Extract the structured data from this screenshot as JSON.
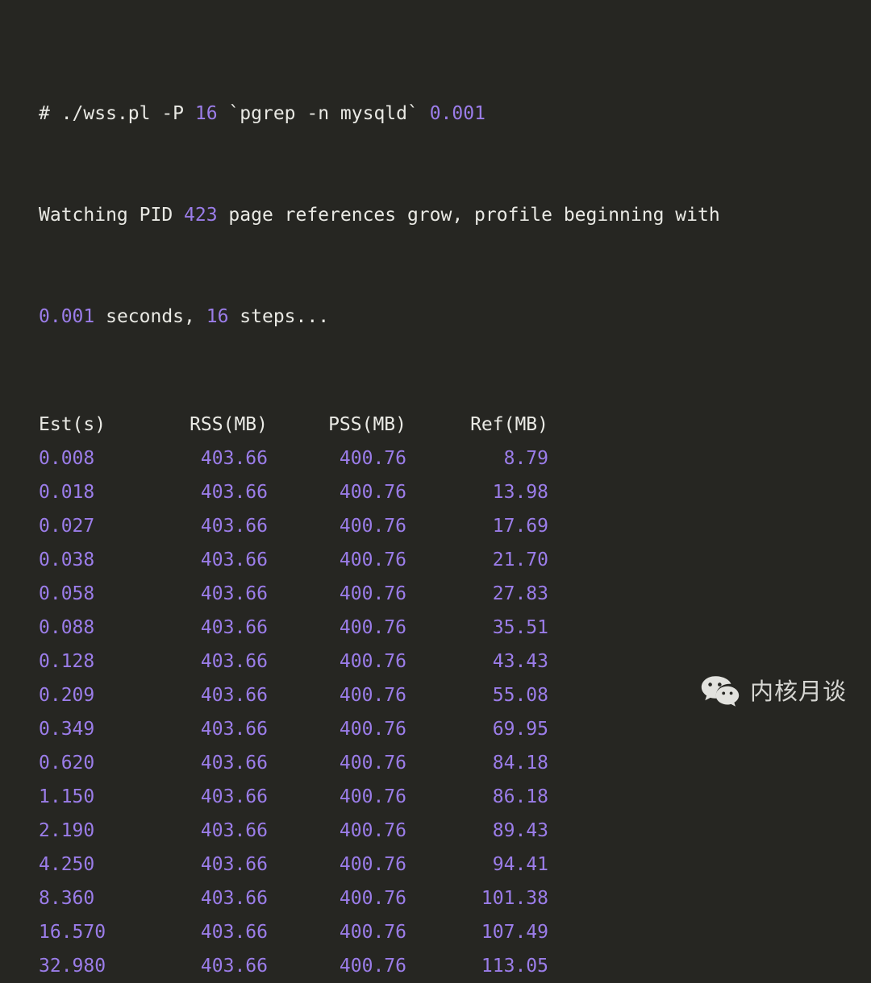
{
  "terminal": {
    "background_color": "#262622",
    "text_color": "#e9e9e4",
    "number_color": "#9b7de9",
    "command_line": {
      "prompt": "# ",
      "script": "./wss.pl -P ",
      "parallel_arg": "16",
      "target": " `pgrep -n mysqld` ",
      "interval": "0.001"
    },
    "status_line": {
      "part1": "Watching PID ",
      "pid": "423",
      "part2": " page references grow, profile beginning with",
      "part3_interval": "0.001",
      "part4": " seconds, ",
      "steps": "16",
      "part5": " steps..."
    }
  },
  "table": {
    "headers": [
      "Est(s)",
      "RSS(MB)",
      "PSS(MB)",
      "Ref(MB)"
    ],
    "rows": [
      [
        "0.008",
        "403.66",
        "400.76",
        "8.79"
      ],
      [
        "0.018",
        "403.66",
        "400.76",
        "13.98"
      ],
      [
        "0.027",
        "403.66",
        "400.76",
        "17.69"
      ],
      [
        "0.038",
        "403.66",
        "400.76",
        "21.70"
      ],
      [
        "0.058",
        "403.66",
        "400.76",
        "27.83"
      ],
      [
        "0.088",
        "403.66",
        "400.76",
        "35.51"
      ],
      [
        "0.128",
        "403.66",
        "400.76",
        "43.43"
      ],
      [
        "0.209",
        "403.66",
        "400.76",
        "55.08"
      ],
      [
        "0.349",
        "403.66",
        "400.76",
        "69.95"
      ],
      [
        "0.620",
        "403.66",
        "400.76",
        "84.18"
      ],
      [
        "1.150",
        "403.66",
        "400.76",
        "86.18"
      ],
      [
        "2.190",
        "403.66",
        "400.76",
        "89.43"
      ],
      [
        "4.250",
        "403.66",
        "400.76",
        "94.41"
      ],
      [
        "8.360",
        "403.66",
        "400.76",
        "101.38"
      ],
      [
        "16.570",
        "403.66",
        "400.76",
        "107.49"
      ],
      [
        "32.980",
        "403.66",
        "400.76",
        "113.05"
      ]
    ]
  },
  "watermark": {
    "icon": "wechat-icon",
    "text": "内核月谈",
    "color": "#d6d6d2"
  }
}
